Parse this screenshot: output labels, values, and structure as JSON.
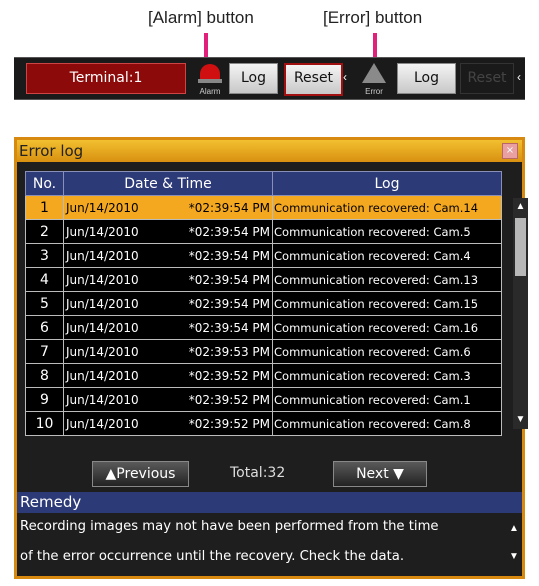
{
  "callouts": {
    "alarm": "[Alarm] button",
    "error": "[Error] button"
  },
  "statusbar": {
    "terminal": "Terminal:1",
    "alarm_small": "Alarm",
    "alarm_log": "Log",
    "alarm_reset": "Reset",
    "error_small": "Error",
    "error_log": "Log",
    "error_reset": "Reset",
    "arrow": "‹"
  },
  "window": {
    "title": "Error log",
    "close": "×",
    "headers": [
      "No.",
      "Date & Time",
      "Log"
    ],
    "rows": [
      {
        "no": "1",
        "date": "Jun/14/2010",
        "time": "*02:39:54 PM",
        "log": "Communication recovered: Cam.14",
        "selected": true
      },
      {
        "no": "2",
        "date": "Jun/14/2010",
        "time": "*02:39:54 PM",
        "log": "Communication recovered: Cam.5"
      },
      {
        "no": "3",
        "date": "Jun/14/2010",
        "time": "*02:39:54 PM",
        "log": "Communication recovered: Cam.4"
      },
      {
        "no": "4",
        "date": "Jun/14/2010",
        "time": "*02:39:54 PM",
        "log": "Communication recovered: Cam.13"
      },
      {
        "no": "5",
        "date": "Jun/14/2010",
        "time": "*02:39:54 PM",
        "log": "Communication recovered: Cam.15"
      },
      {
        "no": "6",
        "date": "Jun/14/2010",
        "time": "*02:39:54 PM",
        "log": "Communication recovered: Cam.16"
      },
      {
        "no": "7",
        "date": "Jun/14/2010",
        "time": "*02:39:53 PM",
        "log": "Communication recovered: Cam.6"
      },
      {
        "no": "8",
        "date": "Jun/14/2010",
        "time": "*02:39:52 PM",
        "log": "Communication recovered: Cam.3"
      },
      {
        "no": "9",
        "date": "Jun/14/2010",
        "time": "*02:39:52 PM",
        "log": "Communication recovered: Cam.1"
      },
      {
        "no": "10",
        "date": "Jun/14/2010",
        "time": "*02:39:52 PM",
        "log": "Communication recovered: Cam.8"
      }
    ],
    "previous": "▲Previous",
    "total": "Total:32",
    "next": "Next ▼",
    "remedy_title": "Remedy",
    "remedy_lines": [
      "Recording images may not have been performed from the time",
      "of the error occurrence until the recovery. Check the data."
    ]
  }
}
